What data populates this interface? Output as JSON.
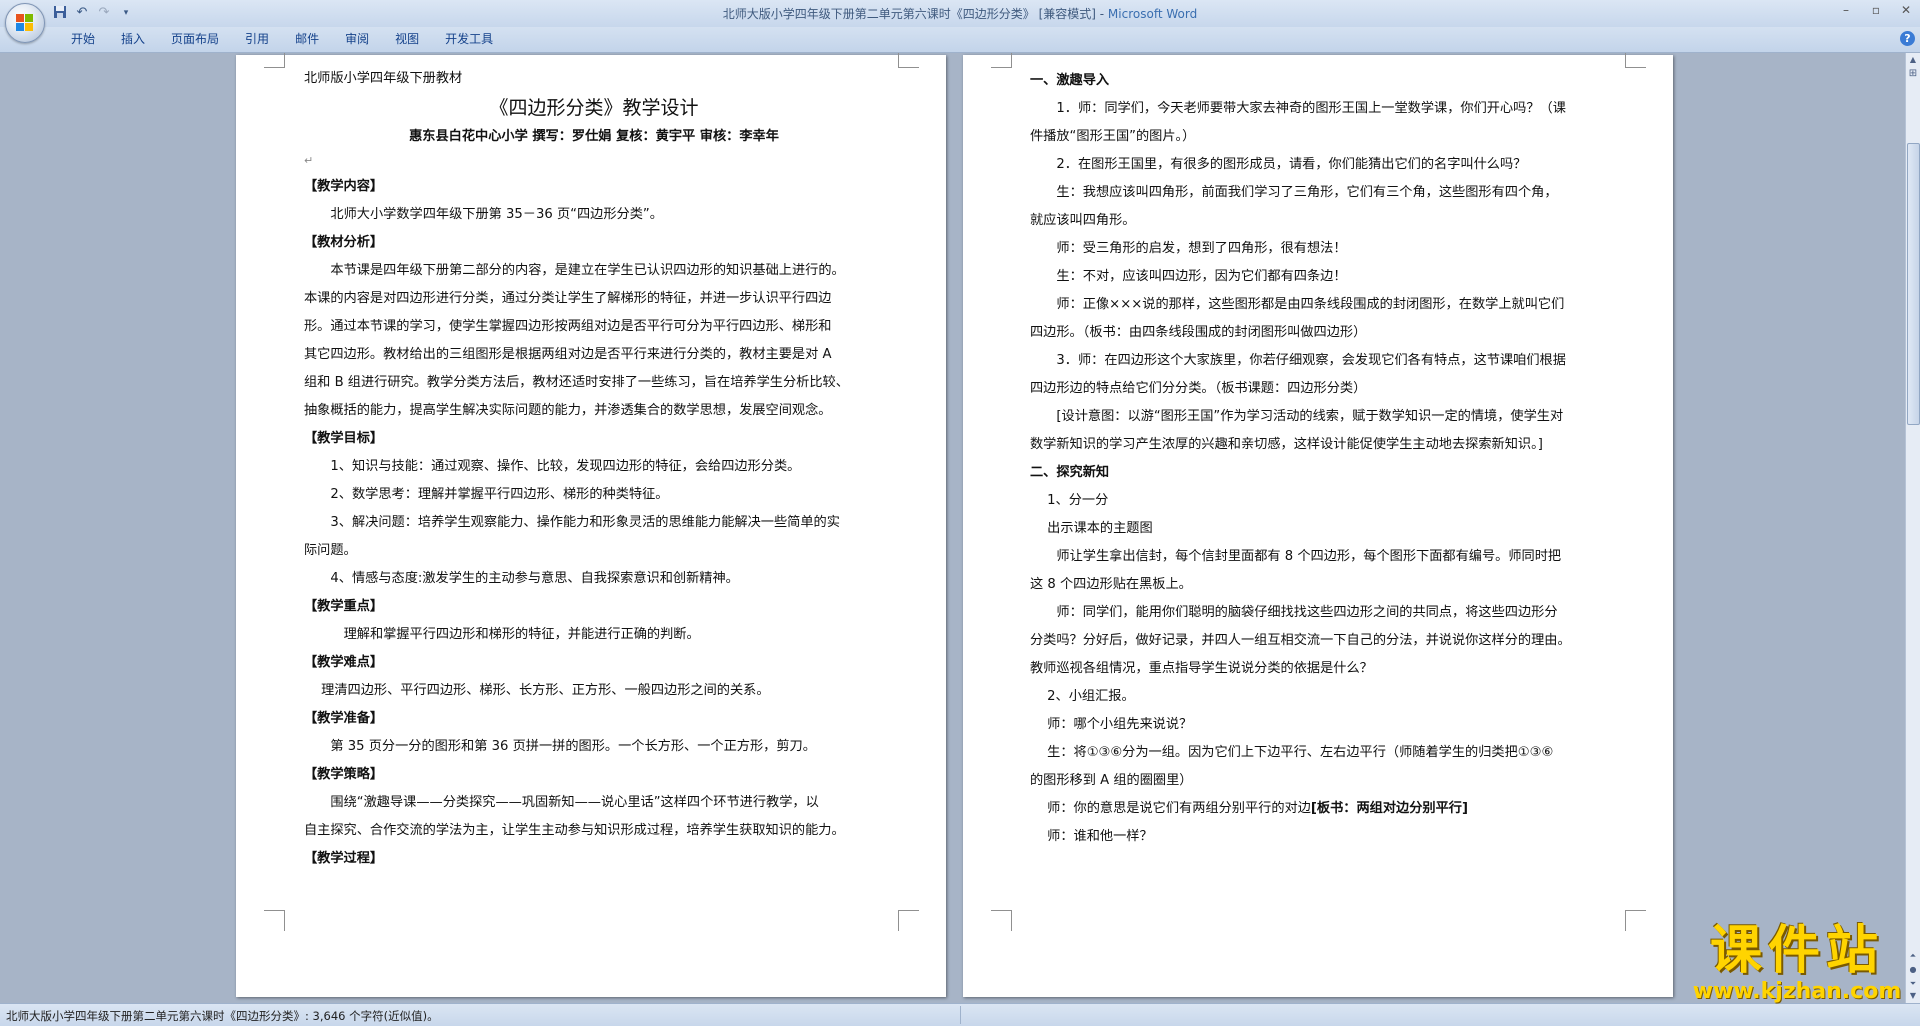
{
  "window": {
    "title_doc": "北师大版小学四年级下册第二单元第六课时《四边形分类》 [兼容模式] - ",
    "title_app": "Microsoft Word"
  },
  "quick_access": {
    "icons": [
      "save-icon",
      "undo-icon",
      "redo-icon",
      "customize-icon"
    ]
  },
  "ribbon": {
    "tabs": [
      "开始",
      "插入",
      "页面布局",
      "引用",
      "邮件",
      "审阅",
      "视图",
      "开发工具"
    ]
  },
  "page1": {
    "header_line": "北师版小学四年级下册教材",
    "title": "《四边形分类》教学设计",
    "authors": "惠东县白花中心小学    撰写：罗仕娟    复核：黄宇平    审核：李幸年",
    "h_content": "【教学内容】",
    "p_content": "北师大小学数学四年级下册第 35－36 页“四边形分类”。",
    "h_analysis": "【教材分析】",
    "p_analysis": [
      "本节课是四年级下册第二部分的内容，是建立在学生已认识四边形的知识基础上进行的。",
      "本课的内容是对四边形进行分类，通过分类让学生了解梯形的特征，并进一步认识平行四边",
      "形。通过本节课的学习，使学生掌握四边形按两组对边是否平行可分为平行四边形、梯形和",
      "其它四边形。教材给出的三组图形是根据两组对边是否平行来进行分类的，教材主要是对 A",
      "组和 B 组进行研究。教学分类方法后，教材还适时安排了一些练习，旨在培养学生分析比较、",
      "抽象概括的能力，提高学生解决实际问题的能力，并渗透集合的数学思想，发展空间观念。"
    ],
    "h_goals": "【教学目标】",
    "goals": [
      "1、知识与技能：通过观察、操作、比较，发现四边形的特征，会给四边形分类。",
      "2、数学思考：理解并掌握平行四边形、梯形的种类特征。",
      "3、解决问题：培养学生观察能力、操作能力和形象灵活的思维能力能解决一些简单的实",
      "际问题。",
      "4、情感与态度:激发学生的主动参与意思、自我探索意识和创新精神。"
    ],
    "h_key": "【教学重点】",
    "p_key": "理解和掌握平行四边形和梯形的特征，并能进行正确的判断。",
    "h_difficult": "【教学难点】",
    "p_difficult": "理清四边形、平行四边形、梯形、长方形、正方形、一般四边形之间的关系。",
    "h_prep": "【教学准备】",
    "p_prep": "第 35 页分一分的图形和第 36 页拼一拼的图形。一个长方形、一个正方形，剪刀。",
    "h_strategy": "【教学策略】",
    "p_strategy": [
      "围绕“激趣导课——分类探究——巩固新知——说心里话”这样四个环节进行教学，以",
      "自主探究、合作交流的学法为主，让学生主动参与知识形成过程，培养学生获取知识的能力。"
    ],
    "h_process": "【教学过程】"
  },
  "page2": {
    "lines": [
      "一、激趣导入",
      "1．师：同学们，今天老师要带大家去神奇的图形王国上一堂数学课，你们开心吗？（课",
      "件播放“图形王国”的图片。）",
      "2．在图形王国里，有很多的图形成员，请看，你们能猜出它们的名字叫什么吗？",
      "生：我想应该叫四角形，前面我们学习了三角形，它们有三个角，这些图形有四个角，",
      "就应该叫四角形。",
      "师：受三角形的启发，想到了四角形，很有想法！",
      "生：不对，应该叫四边形，因为它们都有四条边！",
      "师：正像×××说的那样，这些图形都是由四条线段围成的封闭图形，在数学上就叫它们",
      "四边形。（板书：由四条线段围成的封闭图形叫做四边形）",
      "3．师：在四边形这个大家族里，你若仔细观察，会发现它们各有特点，这节课咱们根据",
      "四边形边的特点给它们分分类。（板书课题：四边形分类）",
      "[设计意图：以游“图形王国”作为学习活动的线索，赋于数学知识一定的情境，使学生对",
      "数学新知识的学习产生浓厚的兴趣和亲切感，这样设计能促使学生主动地去探索新知识。]",
      "二、探究新知",
      "1、分一分",
      "出示课本的主题图",
      "师让学生拿出信封，每个信封里面都有 8 个四边形，每个图形下面都有编号。师同时把",
      "这 8 个四边形贴在黑板上。",
      "师：同学们，能用你们聪明的脑袋仔细找找这些四边形之间的共同点，将这些四边形分",
      "分类吗？分好后，做好记录，并四人一组互相交流一下自己的分法，并说说你这样分的理由。",
      "教师巡视各组情况，重点指导学生说说分类的依据是什么？",
      "2、小组汇报。",
      "师：哪个小组先来说说？",
      "生：将①③⑥分为一组。因为它们上下边平行、左右边平行（师随着学生的归类把①③⑥",
      "的图形移到 A 组的圈圈里）",
      "师：你的意思是说它们有两组分别平行的对边",
      "[板书：两组对边分别平行]",
      "师：谁和他一样？"
    ]
  },
  "status": {
    "text": "北师大版小学四年级下册第二单元第六课时《四边形分类》: 3,646 个字符(近似值)。"
  },
  "watermark": {
    "big": "课件站",
    "url": "www.kjzhan.com"
  }
}
